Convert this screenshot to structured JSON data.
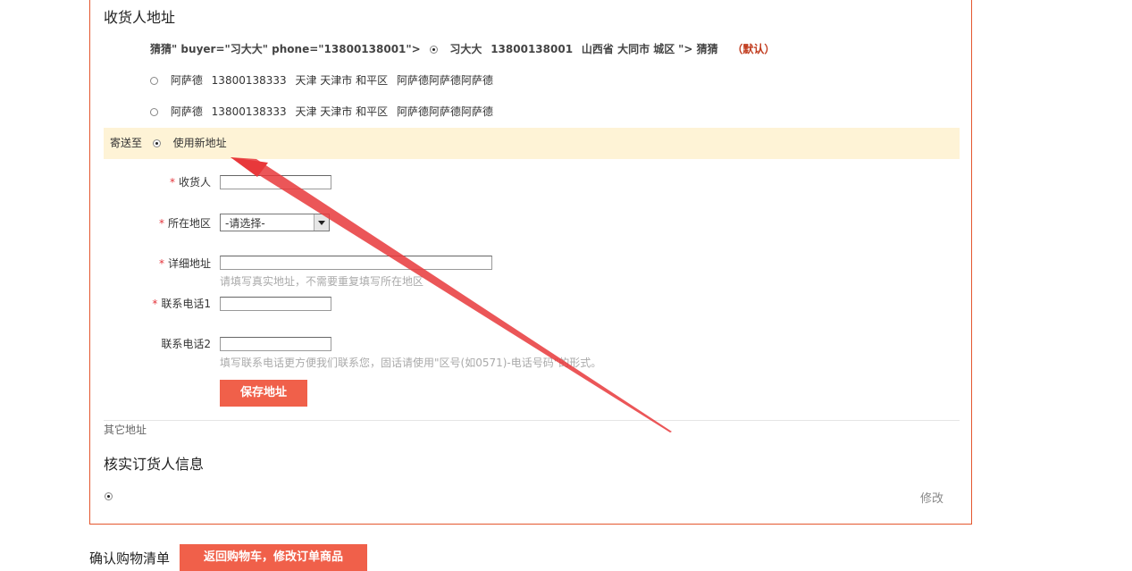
{
  "page": {
    "consignee_title": "收货人地址",
    "verify_title": "核实订货人信息",
    "confirm_cart_title": "确认购物清单"
  },
  "addresses": [
    {
      "prefix": "猜猜\" buyer=\"习大大\" phone=\"13800138001\">",
      "name": "习大大",
      "phone": "13800138001",
      "region": "山西省 大同市 城区",
      "detail": "\"> 猜猜",
      "default_label": "（默认）",
      "checked": true
    },
    {
      "name": "阿萨德",
      "phone": "13800138333",
      "region": "天津 天津市 和平区",
      "detail": "阿萨德阿萨德阿萨德",
      "checked": false
    },
    {
      "name": "阿萨德",
      "phone": "13800138333",
      "region": "天津 天津市 和平区",
      "detail": "阿萨德阿萨德阿萨德",
      "checked": false
    }
  ],
  "new_address": {
    "send_to_label": "寄送至",
    "option_label": "使用新地址",
    "checked": true
  },
  "form": {
    "required_mark": "*",
    "receiver_label": "收货人",
    "receiver_value": "",
    "region_label": "所在地区",
    "region_selected": "-请选择-",
    "detail_label": "详细地址",
    "detail_value": "",
    "detail_hint": "请填写真实地址，不需要重复填写所在地区",
    "phone1_label": "联系电话1",
    "phone1_value": "",
    "phone2_label": "联系电话2",
    "phone2_value": "",
    "phone_hint": "填写联系电话更方便我们联系您，固话请使用\"区号(如0571)-电话号码\"的形式。",
    "save_button": "保存地址"
  },
  "other_address_link": "其它地址",
  "orderer": {
    "checked": true,
    "edit_link": "修改"
  },
  "back_to_cart_button": "返回购物车，修改订单商品",
  "colors": {
    "accent": "#f0604a",
    "border": "#e4572e",
    "highlight": "#fef3d6",
    "arrow": "#e8383b"
  }
}
